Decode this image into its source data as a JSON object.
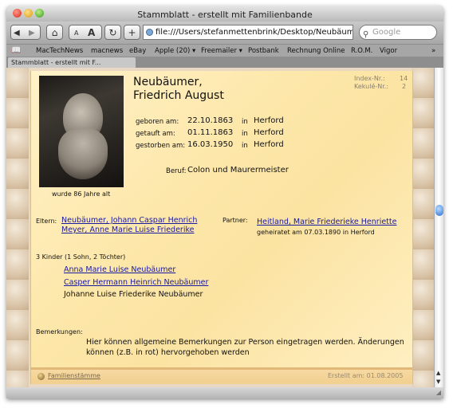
{
  "window": {
    "title": "Stammblatt - erstellt mit Familienbande"
  },
  "toolbar": {
    "back_icon": "back-arrow-icon",
    "forward_icon": "forward-arrow-icon",
    "home_icon": "home-icon",
    "font_small": "A",
    "font_large": "A",
    "reload_icon": "reload-icon",
    "add_icon": "plus-icon",
    "url": "file:///Users/stefanmettenbrink/Desktop/Neubäumer/Neu",
    "search_placeholder": "Google"
  },
  "bookmarks": [
    "MacTechNews",
    "macnews",
    "eBay",
    "Apple (20) ▾",
    "Freemailer ▾",
    "Postbank",
    "Rechnung Online",
    "R.O.M.",
    "Vigor"
  ],
  "tab": {
    "label": "Stammblatt - erstellt mit F..."
  },
  "person": {
    "surname": "Neubäumer,",
    "given": "Friedrich August",
    "index_label": "Index-Nr.:",
    "index_value": "14",
    "kekule_label": "Kekulé-Nr.:",
    "kekule_value": "2",
    "photo_caption": "wurde 86 Jahre alt",
    "events": [
      {
        "label": "geboren am:",
        "date": "22.10.1863",
        "in": "in",
        "place": "Herford"
      },
      {
        "label": "getauft am:",
        "date": "01.11.1863",
        "in": "in",
        "place": "Herford"
      },
      {
        "label": "gestorben am:",
        "date": "16.03.1950",
        "in": "in",
        "place": "Herford"
      }
    ],
    "beruf_label": "Beruf:",
    "beruf_value": "Colon und Maurermeister",
    "eltern_label": "Eltern:",
    "eltern": [
      "Neubäumer, Johann Caspar Henrich",
      "Meyer, Anne Marie Luise Friederike"
    ],
    "partner_label": "Partner:",
    "partner_name": "Heitland, Marie Friederieke Henriette",
    "partner_note": "geheiratet am 07.03.1890 in Herford",
    "children_header": "3 Kinder (1 Sohn, 2 Töchter)",
    "children": [
      {
        "name": "Anna Marie Luise Neubäumer"
      },
      {
        "name": "Casper Hermann Heinrich Neubäumer"
      },
      {
        "name": "Johanne Luise Friederike Neubäumer"
      }
    ],
    "bemerkungen_label": "Bemerkungen:",
    "bemerkungen_line1": "Hier können allgemeine Bemerkungen zur Person eingetragen werden. Änderungen",
    "bemerkungen_line2": "können (z.B. in rot) hervorgehoben werden"
  },
  "footer": {
    "link": "Familienstämme",
    "created": "Erstellt am: 01.08.2005"
  }
}
